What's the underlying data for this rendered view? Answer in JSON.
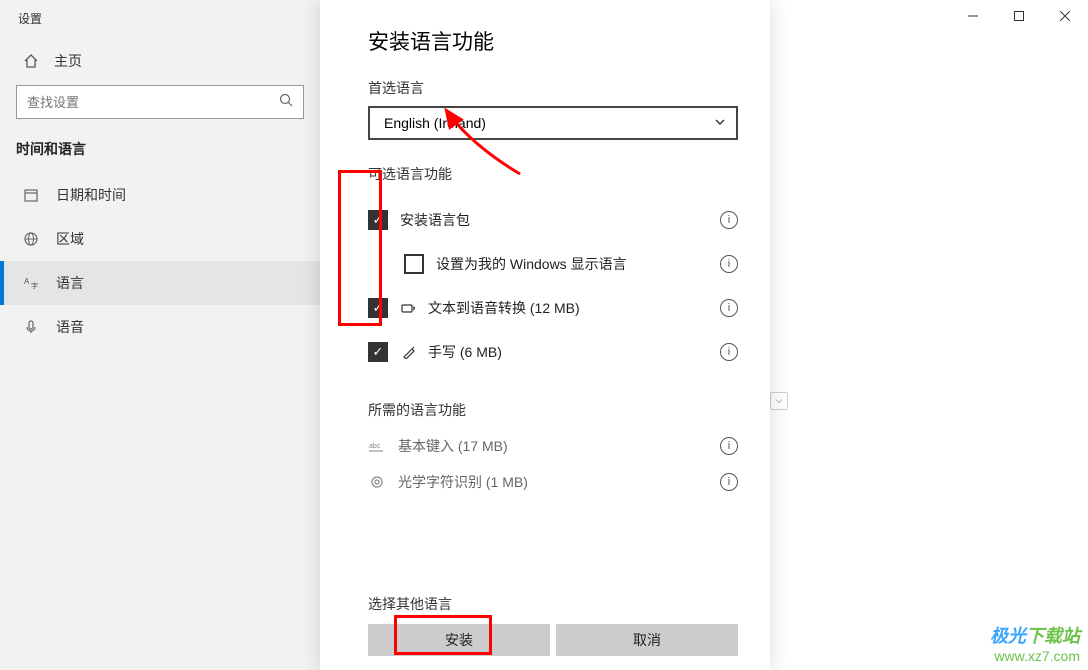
{
  "sidebar": {
    "app_title": "设置",
    "home": "主页",
    "search_placeholder": "查找设置",
    "category": "时间和语言",
    "items": [
      {
        "label": "日期和时间"
      },
      {
        "label": "区域"
      },
      {
        "label": "语言"
      },
      {
        "label": "语音"
      }
    ]
  },
  "modal": {
    "title": "安装语言功能",
    "pref_lang_label": "首选语言",
    "pref_lang_value": "English (Ireland)",
    "optional_label": "可选语言功能",
    "features": {
      "lang_pack": "安装语言包",
      "display_lang": "设置为我的 Windows 显示语言",
      "tts": "文本到语音转换 (12 MB)",
      "handwriting": "手写 (6 MB)"
    },
    "required_label": "所需的语言功能",
    "required": {
      "basic_typing": "基本键入 (17 MB)",
      "ocr": "光学字符识别 (1 MB)"
    },
    "other_lang_label": "选择其他语言",
    "install_btn": "安装",
    "cancel_btn": "取消"
  },
  "watermark": {
    "name": "极光下载站",
    "url": "www.xz7.com"
  }
}
